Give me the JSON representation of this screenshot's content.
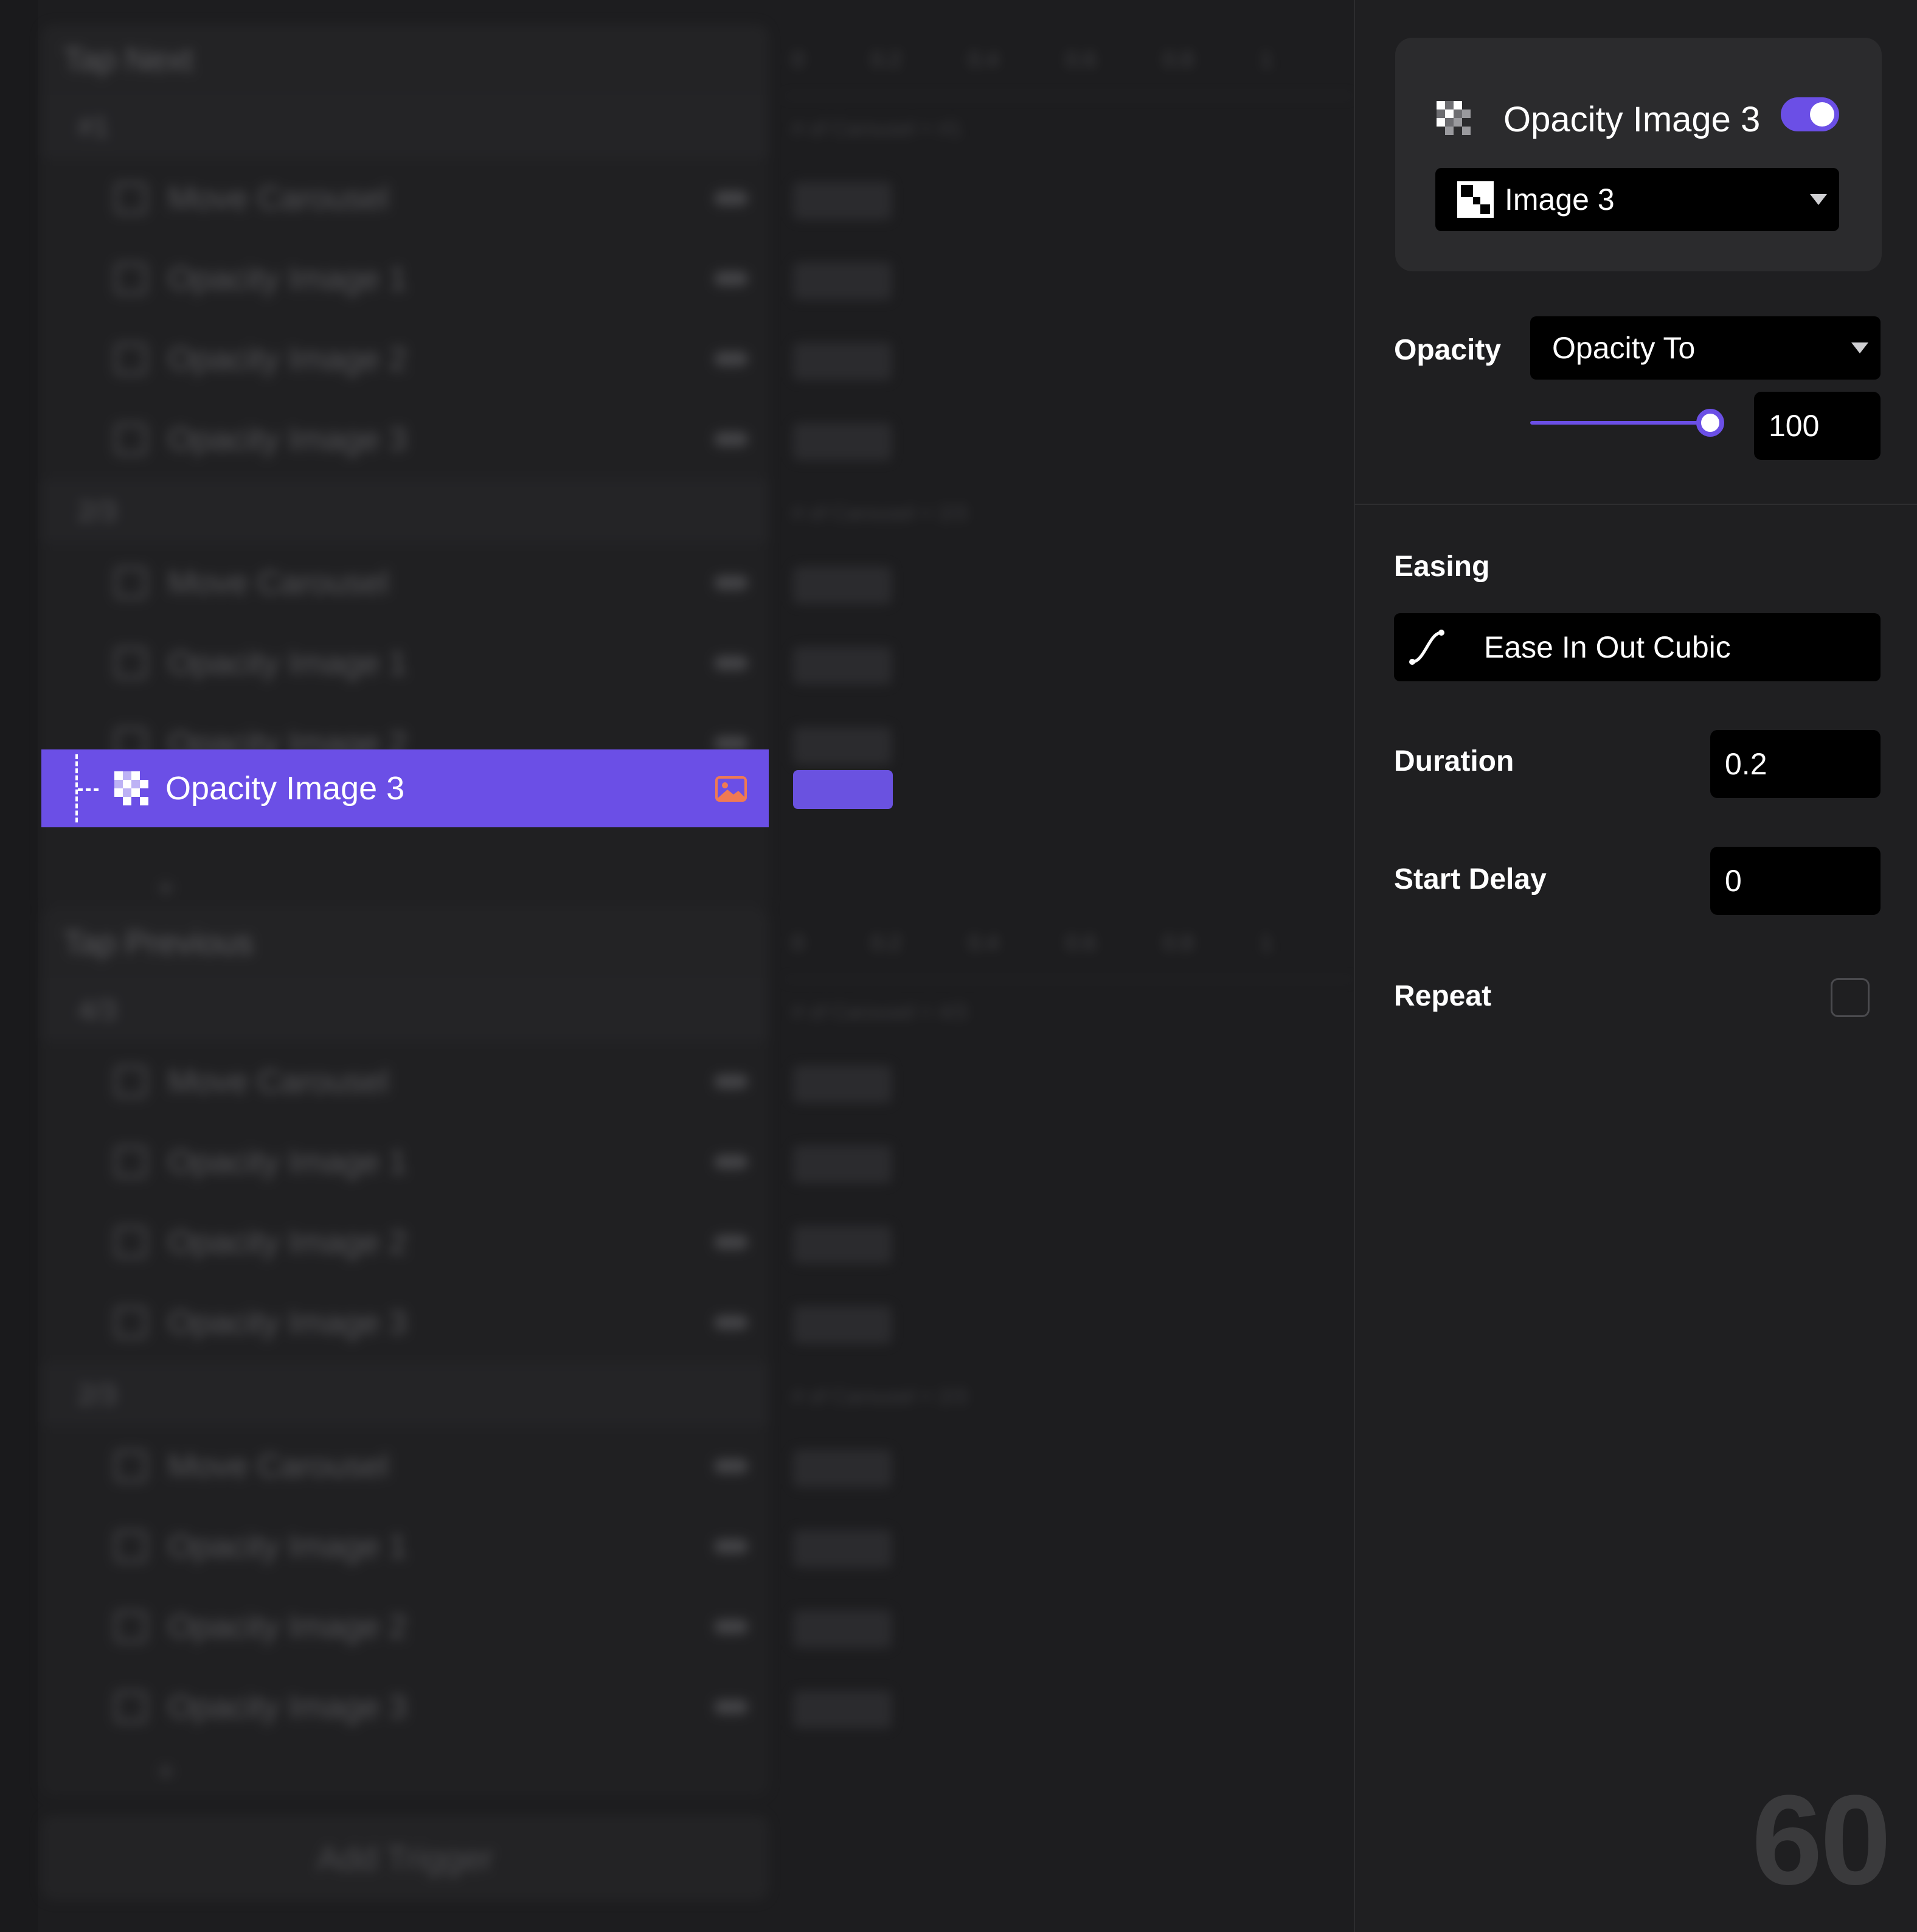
{
  "background": {
    "trees": [
      {
        "title": "Tap Next",
        "groups": [
          {
            "label": "#1",
            "tl": "# of Carousel = #1",
            "rows": [
              "Move Carousel",
              "Opacity Image 1",
              "Opacity Image 2",
              "Opacity Image 3"
            ]
          },
          {
            "label": "2/3",
            "tl": "# of Carousel = 2/3",
            "rows": [
              "Move Carousel",
              "Opacity Image 1",
              "Opacity Image 2"
            ]
          }
        ]
      },
      {
        "title": "Tap Previous",
        "groups": [
          {
            "label": "4/3",
            "tl": "# of Carousel = 4/3",
            "rows": [
              "Move Carousel",
              "Opacity Image 1",
              "Opacity Image 2",
              "Opacity Image 3"
            ]
          },
          {
            "label": "2/3",
            "tl": "# of Carousel = 2/3",
            "rows": [
              "Move Carousel",
              "Opacity Image 1",
              "Opacity Image 2",
              "Opacity Image 3"
            ]
          }
        ]
      }
    ],
    "ruler_ticks": [
      "0",
      "0.2",
      "0.4",
      "0.6",
      "0.8",
      "1"
    ],
    "add_trigger": "Add Trigger"
  },
  "selected_row": {
    "label": "Opacity Image 3",
    "icon": "checker-icon",
    "status_icon": "image-icon"
  },
  "panel": {
    "action_title": "Opacity Image 3",
    "enabled": true,
    "target": "Image 3",
    "opacity_label": "Opacity",
    "opacity_mode": "Opacity To",
    "opacity_value": "100",
    "opacity_level": 100,
    "easing_label": "Easing",
    "easing_value": "Ease In Out Cubic",
    "duration_label": "Duration",
    "duration_value": "0.2",
    "start_delay_label": "Start Delay",
    "start_delay_value": "0",
    "repeat_label": "Repeat",
    "repeat_checked": false
  },
  "fps": "60",
  "colors": {
    "accent": "#6b4fe6",
    "panel_bg": "#1f1f21",
    "card_bg": "#2b2b2d",
    "field_bg": "#000000"
  }
}
